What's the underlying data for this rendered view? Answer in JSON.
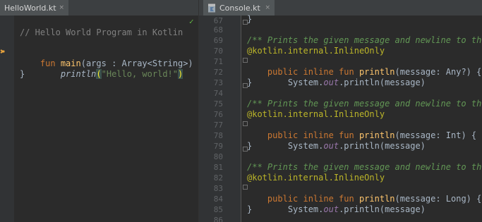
{
  "left_tab": {
    "label": "HelloWorld.kt",
    "close": "×"
  },
  "right_tab": {
    "label": "Console.kt",
    "close": "×"
  },
  "inspection": {
    "status_icon": "✓"
  },
  "left_code": {
    "comment": "// Hello World Program in Kotlin",
    "line_fun_kw": "fun ",
    "line_fun_name": "main",
    "line_fun_params": "(args : Array<String>) {",
    "indent": "    ",
    "call_name": "println",
    "call_open": "(",
    "call_string": "\"Hello, world!\"",
    "call_close": ")",
    "close_brace": "}"
  },
  "right_code": {
    "line_numbers": [
      "67",
      "68",
      "69",
      "70",
      "71",
      "72",
      "73",
      "74",
      "75",
      "76",
      "77",
      "78",
      "79",
      "80",
      "81",
      "82",
      "83",
      "84",
      "85",
      "86"
    ],
    "brace": "}",
    "doc": "/** Prints the given message and newline to the",
    "annotation": "@kotlin.internal.InlineOnly",
    "kw_public_inline_fun": "public inline fun ",
    "fn_name": "println",
    "sig_any": "(message: Any?) {",
    "sig_int": "(message: Int) {",
    "sig_long": "(message: Long) {",
    "body_indent": "    ",
    "body_system": "System.",
    "body_out": "out",
    "body_rest": ".println(message)"
  }
}
